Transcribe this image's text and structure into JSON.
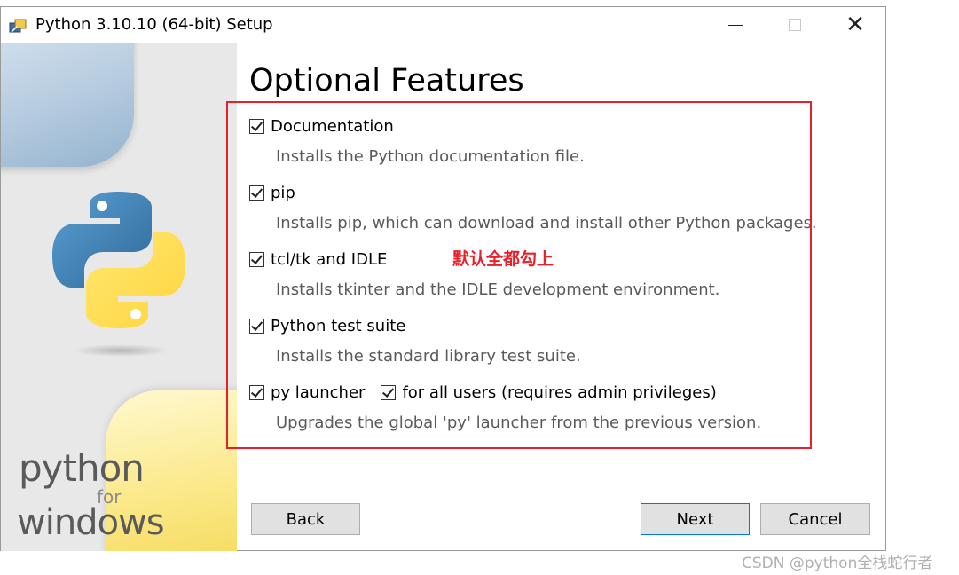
{
  "window": {
    "title": "Python 3.10.10 (64-bit) Setup",
    "minimize_label": "—",
    "close_label": "✕"
  },
  "sidebar": {
    "brand_python": "python",
    "brand_for": "for",
    "brand_windows": "windows"
  },
  "page": {
    "heading": "Optional Features"
  },
  "options": [
    {
      "label": "Documentation",
      "checked": true,
      "description": "Installs the Python documentation file."
    },
    {
      "label": "pip",
      "checked": true,
      "description": "Installs pip, which can download and install other Python packages."
    },
    {
      "label": "tcl/tk and IDLE",
      "checked": true,
      "description": "Installs tkinter and the IDLE development environment."
    },
    {
      "label": "Python test suite",
      "checked": true,
      "description": "Installs the standard library test suite."
    },
    {
      "label": "py launcher",
      "checked": true,
      "description": "Upgrades the global 'py' launcher from the previous version."
    }
  ],
  "sub_option": {
    "label": "for all users (requires admin privileges)",
    "checked": true
  },
  "annotation": {
    "text": "默认全都勾上",
    "color": "#e8202a"
  },
  "buttons": {
    "back": "Back",
    "next": "Next",
    "cancel": "Cancel"
  },
  "watermark": "CSDN @python全栈蛇行者"
}
